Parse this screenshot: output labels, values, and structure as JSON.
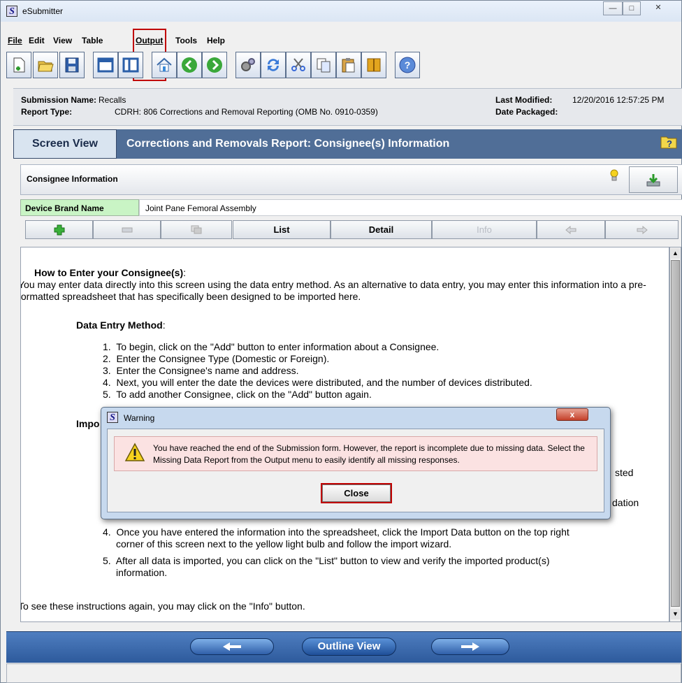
{
  "window": {
    "title": "eSubmitter",
    "logo": "S"
  },
  "menu": [
    "File",
    "Edit",
    "View",
    "Table",
    "Output",
    "Tools",
    "Help"
  ],
  "toolbar_icons": [
    "new-document-icon",
    "open-folder-icon",
    "save-icon",
    "window-icon",
    "panel-icon",
    "home-icon",
    "back-icon",
    "forward-icon",
    "settings-icon",
    "refresh-icon",
    "cut-icon",
    "copy-icon",
    "paste-icon",
    "package-icon",
    "help-icon"
  ],
  "info": {
    "submission_name_label": "Submission Name:",
    "submission_name": "Recalls",
    "report_type_label": "Report Type:",
    "report_type": "CDRH: 806 Corrections and Removal Reporting (OMB No. 0910-0359)",
    "last_modified_label": "Last Modified:",
    "last_modified": "12/20/2016 12:57:25 PM",
    "date_packaged_label": "Date Packaged:"
  },
  "screen": {
    "tab": "Screen View",
    "title": "Corrections and Removals Report: Consignee(s) Information"
  },
  "consignee": {
    "title": "Consignee Information",
    "brand_label": "Device Brand Name",
    "brand_value": "Joint Pane Femoral Assembly"
  },
  "nav": {
    "list": "List",
    "detail": "Detail",
    "info": "Info"
  },
  "content": {
    "heading": "How to Enter your Consignee(s)",
    "intro": "You may enter data directly into this screen using the data entry method. As an alternative to data entry, you may enter this information into a pre-formatted spreadsheet that has specifically been designed to be imported here.",
    "data_entry_heading": "Data Entry Method",
    "data_entry_steps": [
      "To begin, click on the \"Add\" button to enter information about a Consignee.",
      "Enter the Consignee Type (Domestic or Foreign).",
      "Enter the Consignee's name and address.",
      "Next, you will enter the date the devices were distributed, and the number of devices distributed.",
      "To add another Consignee, click on the \"Add\" button again."
    ],
    "import_heading_partial": "Impo",
    "partial_right_1": "sted",
    "partial_right_2": "dation",
    "import_step_4a": "Once you have entered the information into the spreadsheet, click the Import Data button on the top right",
    "import_step_4b": "corner of this screen next to the yellow light bulb and follow the import wizard.",
    "import_step_5a": "After all data is imported, you can click on the \"List\" button to view and verify the imported product(s)",
    "import_step_5b": "information.",
    "footer": "To see these instructions again, you may click on the \"Info\" button."
  },
  "bottom": {
    "outline": "Outline View"
  },
  "dialog": {
    "title": "Warning",
    "close_x": "x",
    "message": "You have reached the end of the Submission form. However, the report is incomplete due to missing data. Select the Missing Data Report from the Output menu to easily identify all missing responses.",
    "button": "Close"
  }
}
